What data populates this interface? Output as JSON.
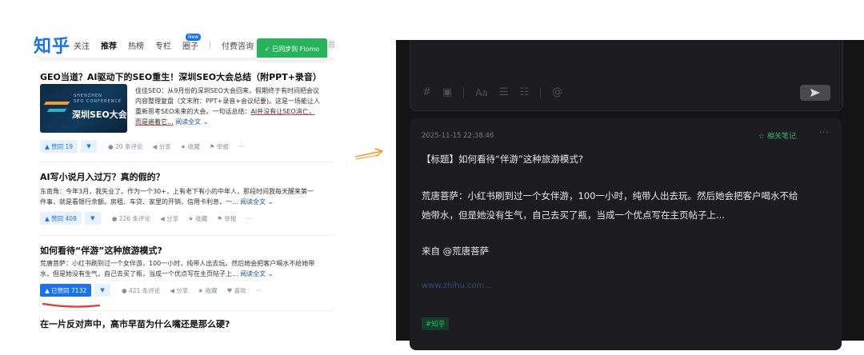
{
  "zhihu": {
    "logo": "知乎",
    "nav": [
      "关注",
      "推荐",
      "热榜",
      "专栏",
      "圈子",
      "付费咨询",
      "知"
    ],
    "new_badge": "New",
    "nav_more": "员",
    "toast": "✓ 已同步到 Flomo",
    "feed": [
      {
        "title": "GEO当道？AI驱动下的SEO重生！深圳SEO大会总结（附PPT+录音）",
        "thumb_sub": "SHENZHEN\nSEO CONFERENCE",
        "thumb_title": "深圳SEO大会",
        "excerpt_lines": [
          "佳佳SEO：从9月份的深圳SEO大会回来，假期终于有时间把会议",
          "内容整理复盘（文末附：PPT+录音+会议纪要)。这是一场能让人",
          "重新思考SEO未来的大会。一句话总结：",
          "而是遍着它..."
        ],
        "excerpt_highlight": "AI并没有让SEO消亡，",
        "read_more": "阅读全文",
        "vote": "▲ 赞同 19",
        "actions": [
          "● 20 条评论",
          "◀ 分享",
          "★ 收藏",
          "⚑ 举报",
          "···"
        ]
      },
      {
        "title": "AI写小说月入过万？真的假的？",
        "excerpt_lines": [
          "东南角：今年3月，我失业了。作为一个30+，上有老下有小的中年人，那段时间我每天醒来第一",
          "件事，就是看银行余额。房租、车贷、家里的开销，信用卡利息，一..."
        ],
        "read_more": "阅读全文",
        "vote": "▲ 赞同 408",
        "actions": [
          "● 226 条评论",
          "◀ 分享",
          "★ 收藏",
          "⚑ 举报",
          "···"
        ]
      },
      {
        "title": "如何看待“伴游”这种旅游模式?",
        "excerpt_lines": [
          "荒唐菩萨：小红书刷到过一个女伴游，100一小时，纯带人出去玩。然后她会把客户喝水不给她带",
          "水，但是她没有生气，自己去买了瓶，当成一个优点写在主页帖子上..."
        ],
        "read_more": "阅读全文",
        "vote": "▲ 已赞同 7132",
        "actions": [
          "● 421 条评论",
          "◀ 分享",
          "★ 收藏",
          "♥ 喜欢",
          "···"
        ]
      },
      {
        "title": "在一片反对声中，高市早苗为什么嘴还是那么硬?"
      }
    ]
  },
  "flomo": {
    "toolbar_icons": [
      "#",
      "▣",
      "Aa",
      "☰",
      "☷",
      "@"
    ],
    "send_icon": "send-icon",
    "memo": {
      "time": "2025-11-15 22:38:46",
      "related": "相关笔记",
      "more": "···",
      "title_line": "【标题】如何看待“伴游”这种旅游模式?",
      "body_line1": "荒唐菩萨：小红书刷到过一个女伴游，100一小时，纯带人出去玩。然后她会把客户喝水不给",
      "body_line2": "她带水，但是她没有生气，自己去买了瓶，当成一个优点写在主页帖子上...",
      "source": "来自 @荒唐菩萨",
      "link": "www.zhihu.com...",
      "tag": "#知乎"
    }
  },
  "colors": {
    "zhihu_blue": "#1772f6",
    "flomo_green": "#2fb572",
    "dark_bg": "#141415",
    "annotation": "#f59a23"
  }
}
